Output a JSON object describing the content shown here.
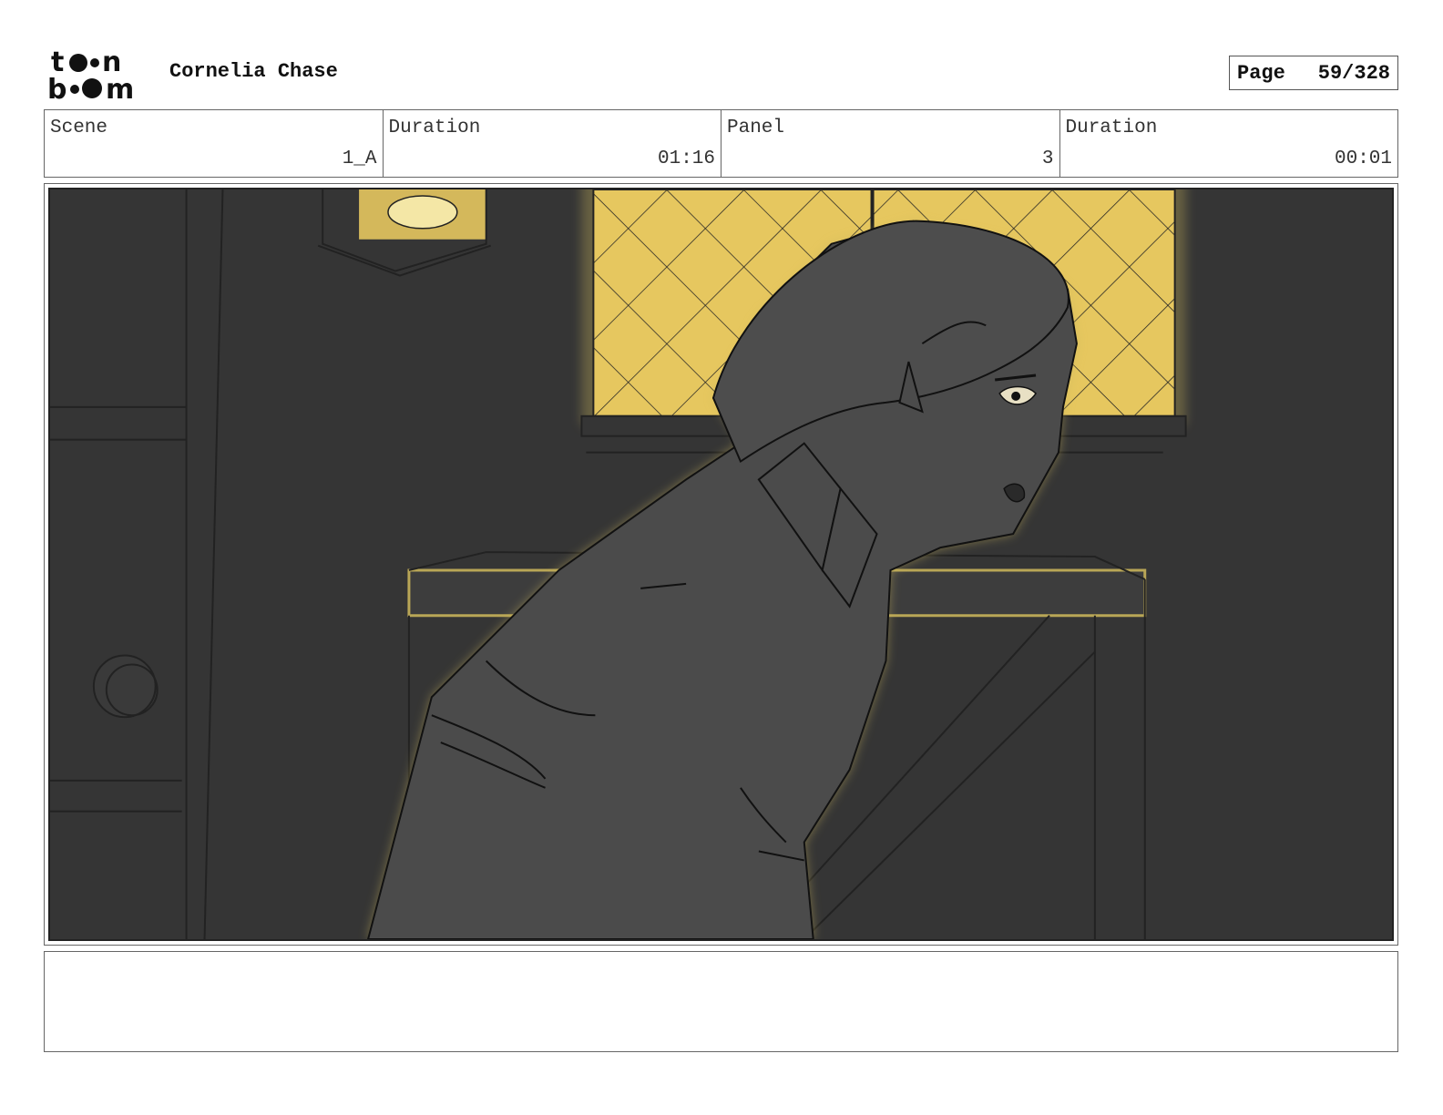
{
  "header": {
    "logo_text": "toon boom",
    "project_title": "Cornelia Chase",
    "page_label": "Page",
    "page_number": "59/328"
  },
  "info": {
    "scene_label": "Scene",
    "scene_value": "1_A",
    "duration_label": "Duration",
    "duration_value": "01:16",
    "panel_label": "Panel",
    "panel_value": "3",
    "panel_duration_label": "Duration",
    "panel_duration_value": "00:01"
  },
  "colors": {
    "wall": "#353535",
    "window_glow": "#e6c75f",
    "figure_fill": "#4b4b4b",
    "rim_light": "#c8b35a",
    "line": "#111111"
  }
}
